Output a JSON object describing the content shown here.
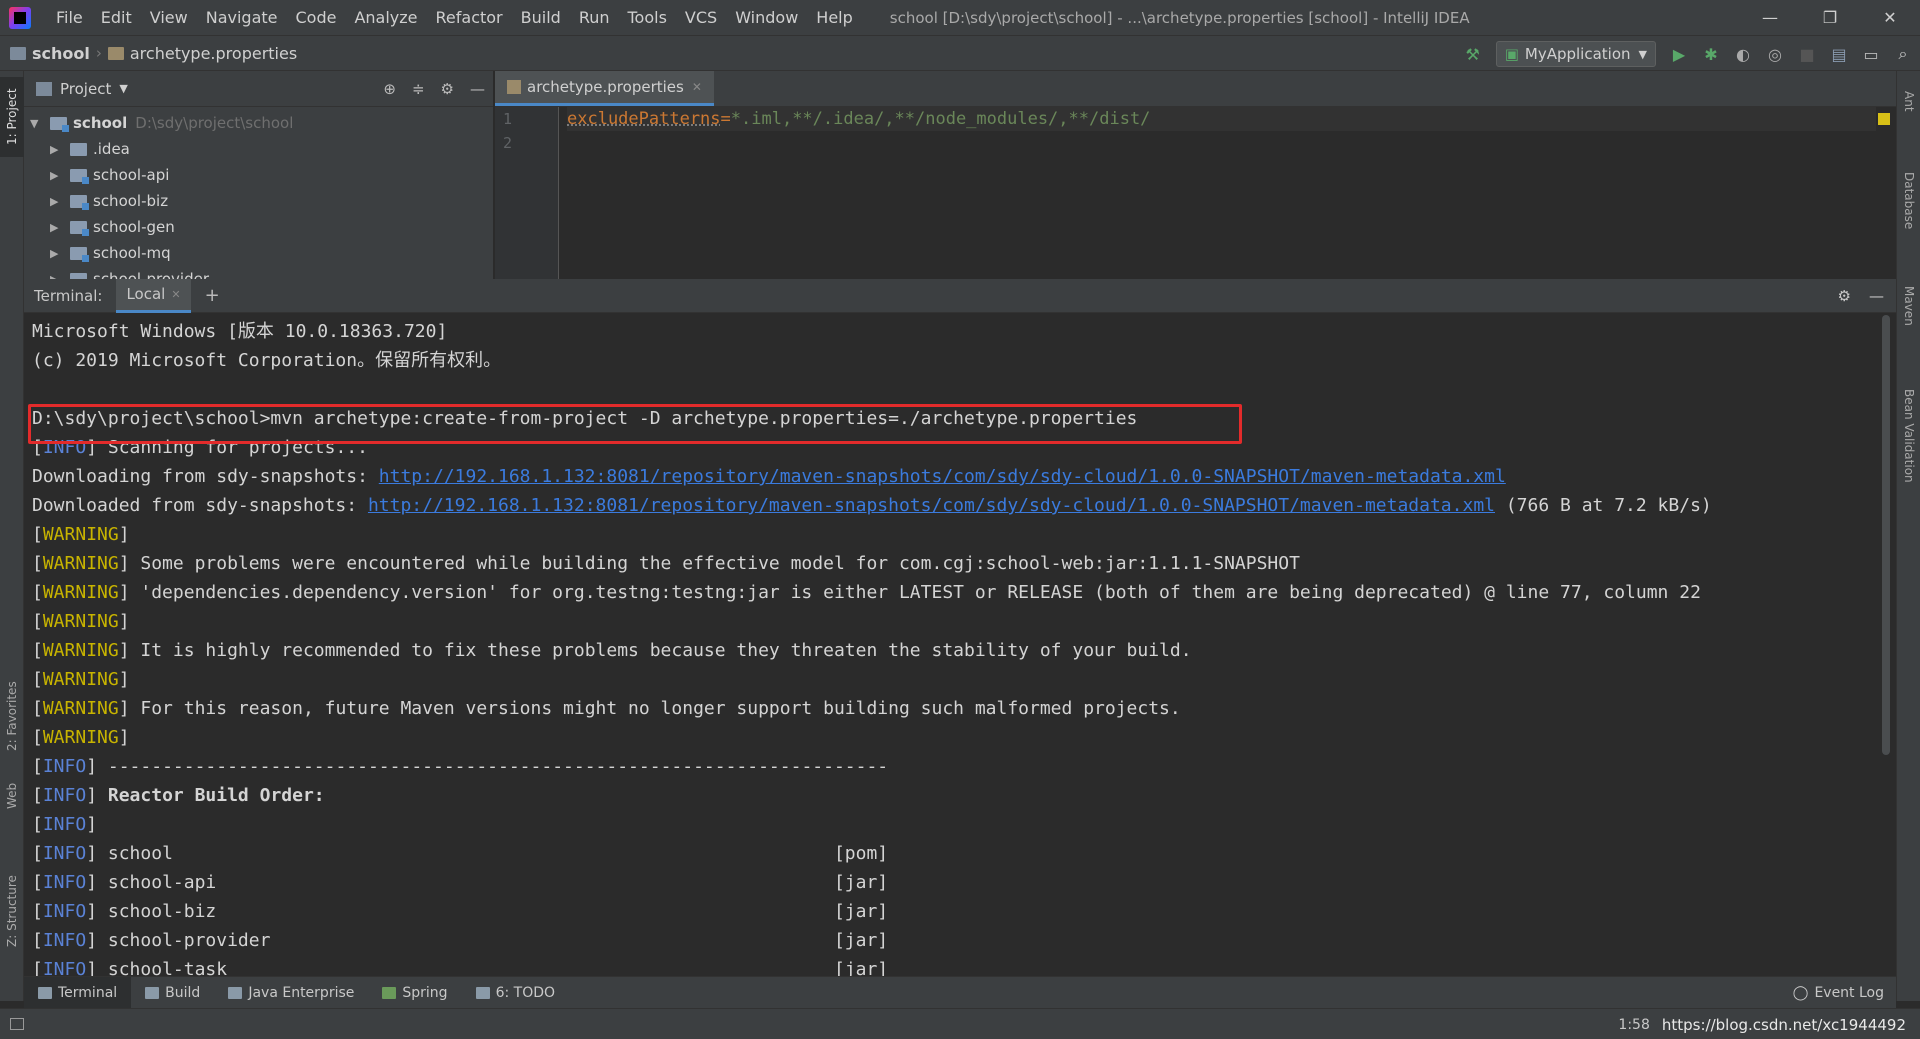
{
  "window": {
    "title": "school [D:\\sdy\\project\\school] - ...\\archetype.properties [school] - IntelliJ IDEA",
    "controls": [
      "—",
      "❐",
      "✕"
    ]
  },
  "menu": [
    "File",
    "Edit",
    "View",
    "Navigate",
    "Code",
    "Analyze",
    "Refactor",
    "Build",
    "Run",
    "Tools",
    "VCS",
    "Window",
    "Help"
  ],
  "navbar": {
    "crumbs": [
      "school",
      "archetype.properties"
    ],
    "run_config": "MyApplication"
  },
  "side_tabs": {
    "left": [
      "1: Project",
      "2: Favorites",
      "Web",
      "Z: Structure"
    ],
    "right": [
      "Ant",
      "Database",
      "Maven",
      "Bean Validation"
    ]
  },
  "project": {
    "header": "Project",
    "root": {
      "name": "school",
      "path": "D:\\sdy\\project\\school"
    },
    "items": [
      ".idea",
      "school-api",
      "school-biz",
      "school-gen",
      "school-mq",
      "school-provider"
    ]
  },
  "editor": {
    "tab": "archetype.properties",
    "line_numbers": [
      "1",
      "2"
    ],
    "key": "excludePatterns",
    "value": "*.iml,**/.idea/,**/node_modules/,**/dist/"
  },
  "terminal": {
    "label": "Terminal:",
    "tab": "Local",
    "lines": [
      {
        "type": "plain",
        "text": "Microsoft Windows [版本 10.0.18363.720]"
      },
      {
        "type": "plain",
        "text": "(c) 2019 Microsoft Corporation。保留所有权利。"
      },
      {
        "type": "blank",
        "text": ""
      },
      {
        "type": "command",
        "text": "D:\\sdy\\project\\school>mvn archetype:create-from-project -D archetype.properties=./archetype.properties"
      },
      {
        "type": "info",
        "text": " Scanning for projects..."
      },
      {
        "type": "download",
        "prefix": "Downloading from sdy-snapshots: ",
        "url": "http://192.168.1.132:8081/repository/maven-snapshots/com/sdy/sdy-cloud/1.0.0-SNAPSHOT/maven-metadata.xml",
        "suffix": ""
      },
      {
        "type": "download",
        "prefix": "Downloaded from sdy-snapshots: ",
        "url": "http://192.168.1.132:8081/repository/maven-snapshots/com/sdy/sdy-cloud/1.0.0-SNAPSHOT/maven-metadata.xml",
        "suffix": " (766 B at 7.2 kB/s)"
      },
      {
        "type": "warning",
        "text": ""
      },
      {
        "type": "warning",
        "text": " Some problems were encountered while building the effective model for com.cgj:school-web:jar:1.1.1-SNAPSHOT"
      },
      {
        "type": "warning",
        "text": " 'dependencies.dependency.version' for org.testng:testng:jar is either LATEST or RELEASE (both of them are being deprecated) @ line 77, column 22"
      },
      {
        "type": "warning",
        "text": ""
      },
      {
        "type": "warning",
        "text": " It is highly recommended to fix these problems because they threaten the stability of your build."
      },
      {
        "type": "warning",
        "text": ""
      },
      {
        "type": "warning",
        "text": " For this reason, future Maven versions might no longer support building such malformed projects."
      },
      {
        "type": "warning",
        "text": ""
      },
      {
        "type": "info",
        "text": " ------------------------------------------------------------------------"
      },
      {
        "type": "info-bold",
        "text": " Reactor Build Order:"
      },
      {
        "type": "info",
        "text": ""
      },
      {
        "type": "info",
        "text": " school                                                             [pom]"
      },
      {
        "type": "info",
        "text": " school-api                                                         [jar]"
      },
      {
        "type": "info",
        "text": " school-biz                                                         [jar]"
      },
      {
        "type": "info",
        "text": " school-provider                                                    [jar]"
      },
      {
        "type": "info",
        "text": " school-task                                                        [jar]"
      }
    ],
    "warn_tag": "WARNING",
    "info_tag": "INFO"
  },
  "bottom_tabs": [
    "Terminal",
    "Build",
    "Java Enterprise",
    "Spring",
    "6: TODO"
  ],
  "event_log": "Event Log",
  "status": {
    "position": "1:58",
    "watermark": "https://blog.csdn.net/xc1944492"
  },
  "colors": {
    "highlight_box": "#e32b2b",
    "warning": "#c8b400",
    "info": "#5a82d6",
    "link": "#3b7bde"
  }
}
